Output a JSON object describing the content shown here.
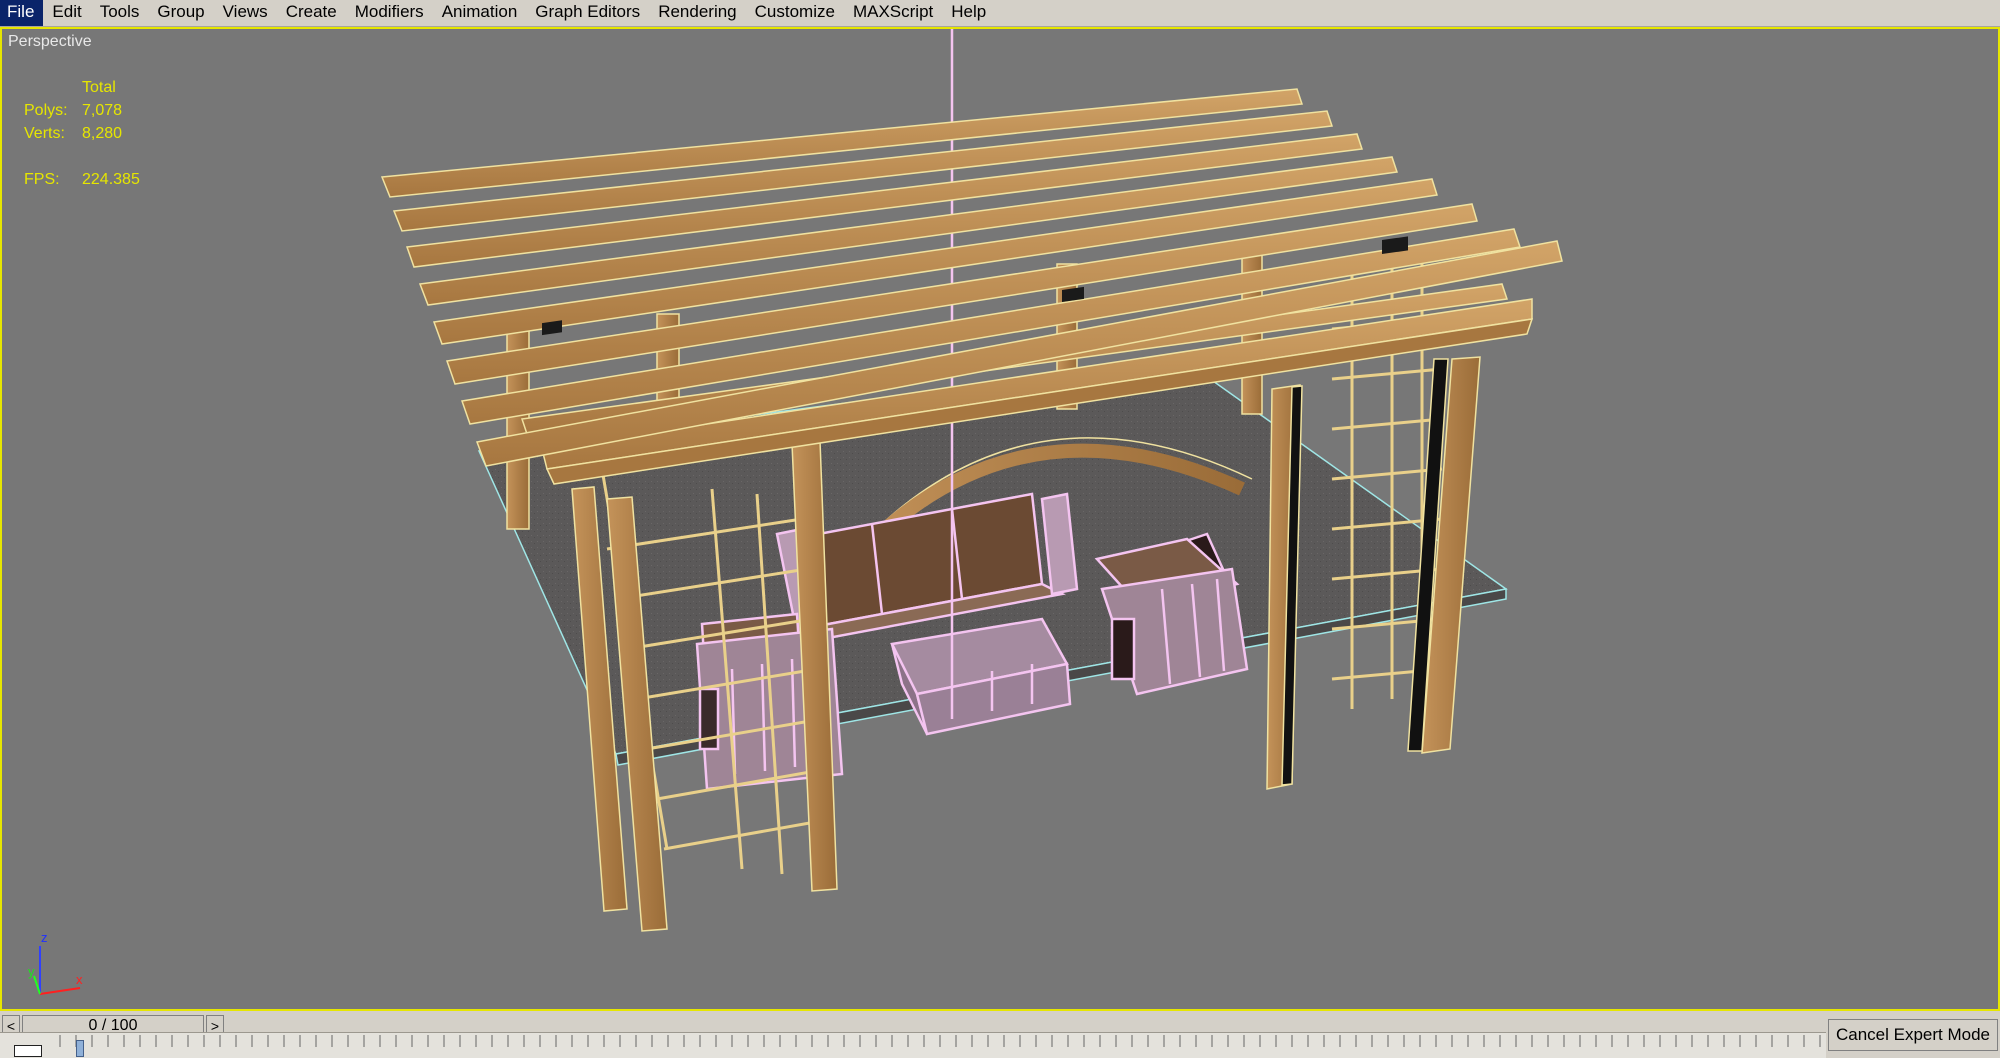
{
  "menu": [
    "File",
    "Edit",
    "Tools",
    "Group",
    "Views",
    "Create",
    "Modifiers",
    "Animation",
    "Graph Editors",
    "Rendering",
    "Customize",
    "MAXScript",
    "Help"
  ],
  "viewport": {
    "label": "Perspective",
    "stats": {
      "header": "Total",
      "polys_label": "Polys:",
      "polys_value": "7,078",
      "verts_label": "Verts:",
      "verts_value": "8,280",
      "fps_label": "FPS:",
      "fps_value": "224.385"
    },
    "axis": {
      "z": "z",
      "y": "y",
      "x": "x"
    }
  },
  "timeline": {
    "frame_display": "0 / 100",
    "left_arrow": "<",
    "right_arrow": ">"
  },
  "expert_mode": {
    "cancel_label": "Cancel Expert Mode"
  },
  "colors": {
    "viewport_bg": "#777777",
    "active_border": "#e6e600",
    "stats_text": "#e6e600",
    "wood": "#b98b4f",
    "furniture_wire": "#f4c4f0",
    "floor": "#5a5858"
  },
  "icons": [
    "axis-tripod-icon",
    "key-icon",
    "chevron-left-icon",
    "chevron-right-icon"
  ]
}
